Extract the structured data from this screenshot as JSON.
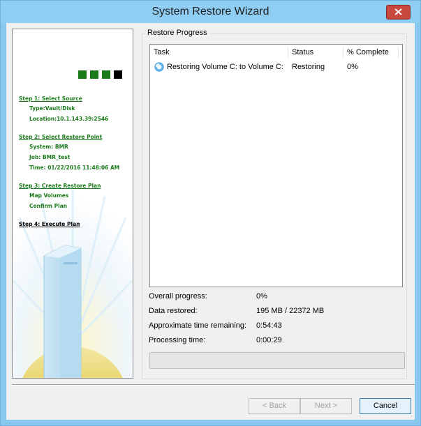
{
  "window": {
    "title": "System Restore Wizard"
  },
  "left_panel": {
    "progress_squares": [
      "#1a7a1a",
      "#1a7a1a",
      "#1a7a1a",
      "#000000"
    ],
    "steps": [
      {
        "title": "Step 1: Select Source",
        "items": [
          "Type:Vault/Disk",
          "Location:10.1.143.39:2546"
        ]
      },
      {
        "title": "Step 2: Select Restore Point",
        "items": [
          "System: BMR",
          "Job: BMR_test",
          "Time: 01/22/2016 11:48:06 AM"
        ]
      },
      {
        "title": "Step 3: Create Restore Plan",
        "items": [
          "Map Volumes",
          "Confirm Plan"
        ]
      },
      {
        "title": "Step 4: Execute Plan",
        "items": []
      }
    ]
  },
  "restore_progress": {
    "group_label": "Restore Progress",
    "columns": [
      "Task",
      "Status",
      "% Complete"
    ],
    "rows": [
      {
        "icon": "spinner-icon",
        "task": "Restoring Volume C: to Volume C:",
        "status": "Restoring",
        "percent": "0%"
      }
    ]
  },
  "stats": {
    "overall_label": "Overall progress:",
    "overall_value": "0%",
    "data_label": "Data restored:",
    "data_value": "195 MB / 22372 MB",
    "remaining_label": "Approximate time remaining:",
    "remaining_value": "0:54:43",
    "processing_label": "Processing time:",
    "processing_value": "0:00:29"
  },
  "progress_bar": {
    "fraction": 0.0
  },
  "buttons": {
    "back": "< Back",
    "next": "Next >",
    "cancel": "Cancel"
  },
  "colors": {
    "step_done": "#1a7a1a",
    "step_current": "#000000",
    "title_bar": "#8fcdf3"
  }
}
